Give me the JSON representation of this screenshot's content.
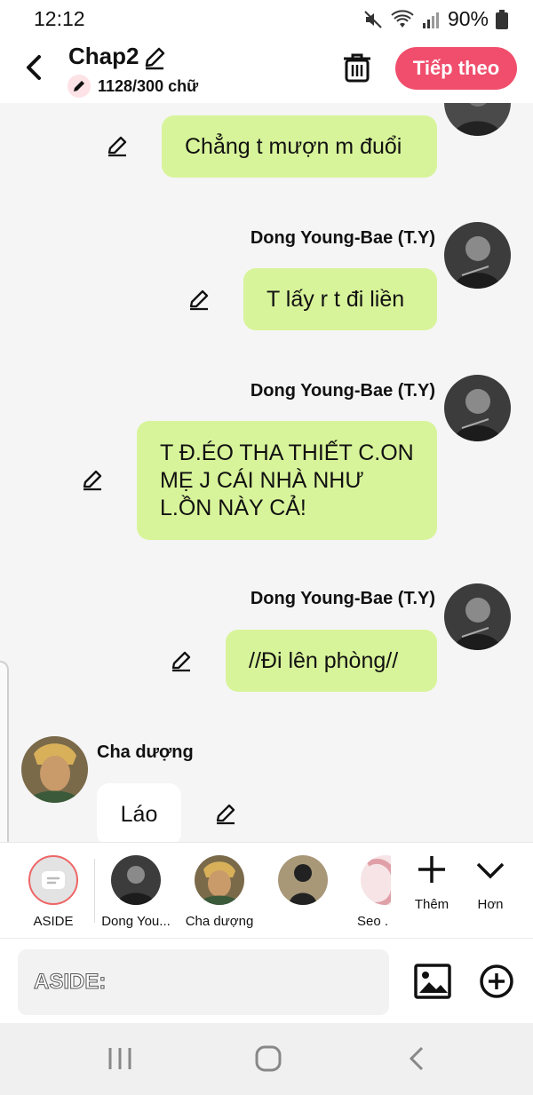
{
  "status": {
    "time": "12:12",
    "battery": "90%"
  },
  "header": {
    "title": "Chap2",
    "word_count": "1128/300 chữ",
    "next_label": "Tiếp theo"
  },
  "messages": [
    {
      "sender": "",
      "text": "Chẳng t mượn m đuổi"
    },
    {
      "sender": "Dong Young-Bae (T.Y)",
      "text": "T lấy r t đi liền"
    },
    {
      "sender": "Dong Young-Bae (T.Y)",
      "text": "T Đ.ÉO THA THIẾT C.ON MẸ J CÁI NHÀ NHƯ L.ỒN NÀY CẢ!"
    },
    {
      "sender": "Dong Young-Bae (T.Y)",
      "text": "//Đi lên phòng//"
    },
    {
      "sender": "Cha dượng",
      "text": "Láo"
    }
  ],
  "characters": [
    {
      "label": "ASIDE"
    },
    {
      "label": "Dong You..."
    },
    {
      "label": "Cha dượng"
    },
    {
      "label": ""
    },
    {
      "label": "Seo ."
    }
  ],
  "tools": {
    "more_label": "Thêm",
    "collapse_label": "Hơn"
  },
  "composer": {
    "placeholder": "ASIDE:"
  },
  "colors": {
    "accent": "#f04e6c",
    "bubble": "#d8f49a"
  }
}
